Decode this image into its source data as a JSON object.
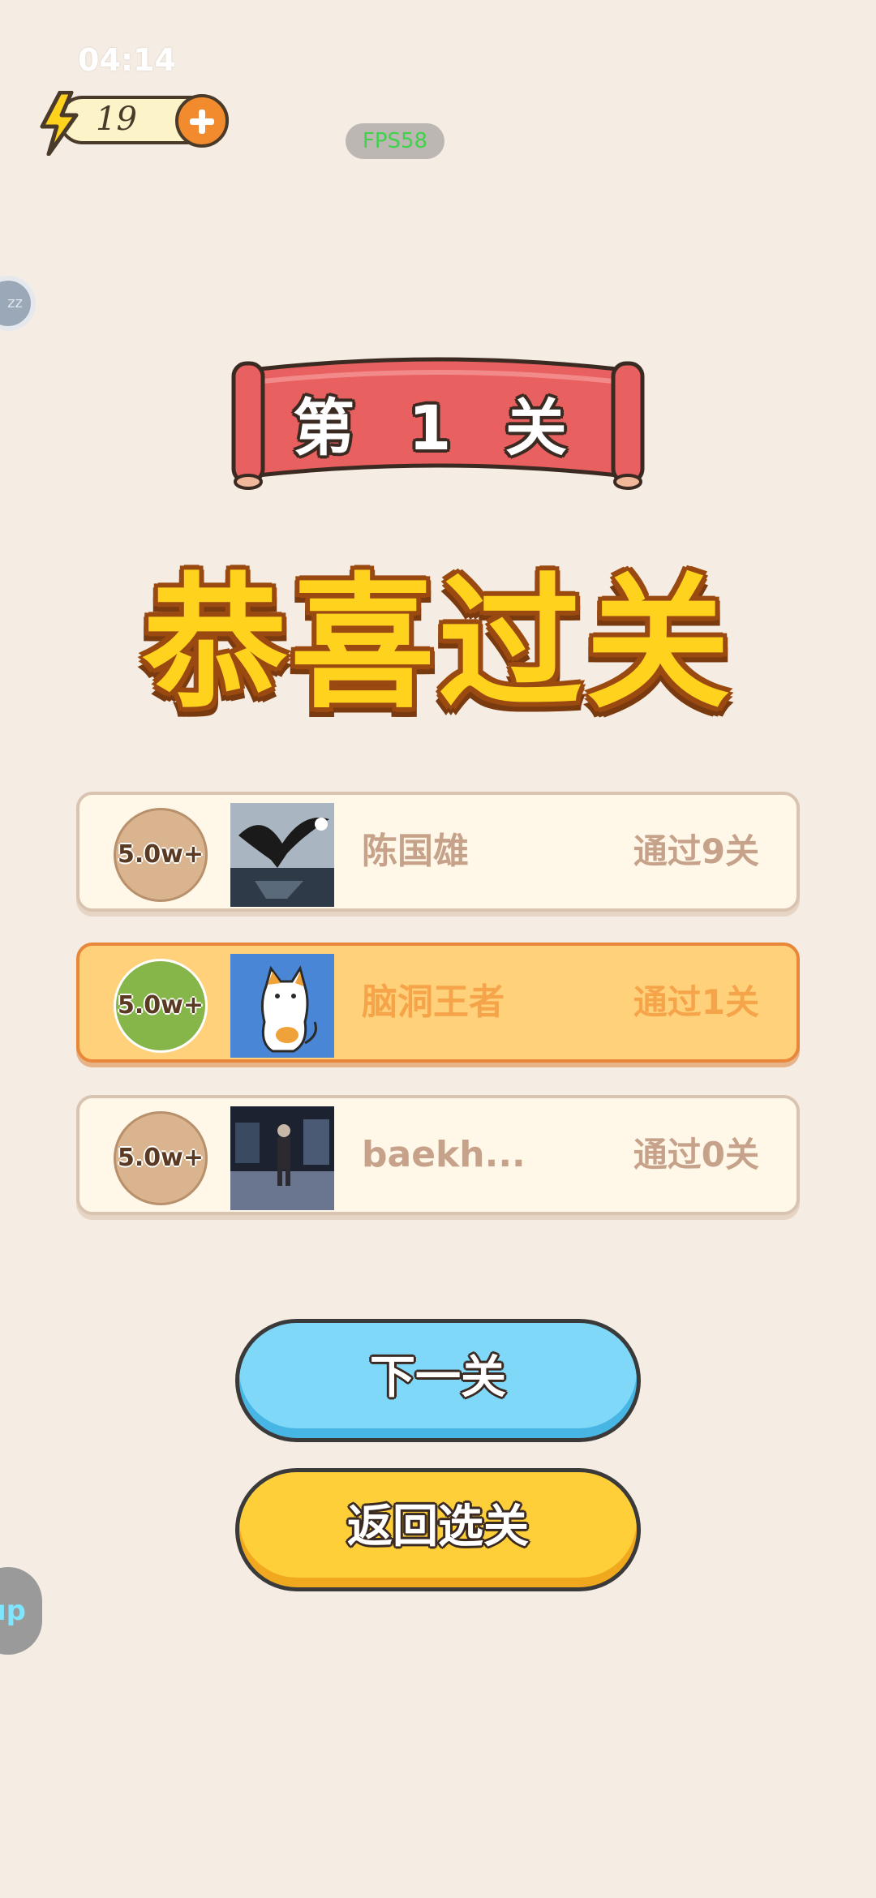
{
  "status": {
    "time": "04:14"
  },
  "energy": {
    "count": "19"
  },
  "fps": "FPS58",
  "float_buttons": {
    "zz": "zz",
    "up": "up"
  },
  "banner": {
    "level": "第 1 关"
  },
  "congrats": "恭喜过关",
  "ranking": [
    {
      "badge": "5.0w+",
      "name": "陈国雄",
      "progress": "通过9关",
      "highlight": false,
      "avatar": "eagle-avatar"
    },
    {
      "badge": "5.0w+",
      "name": "脑洞王者",
      "progress": "通过1关",
      "highlight": true,
      "avatar": "cat-avatar"
    },
    {
      "badge": "5.0w+",
      "name": "baekh...",
      "progress": "通过0关",
      "highlight": false,
      "avatar": "person-avatar"
    }
  ],
  "buttons": {
    "next": "下一关",
    "back": "返回选关"
  },
  "colors": {
    "background": "#f5ece3",
    "next_button": "#7fd8f8",
    "back_button": "#ffcf3a",
    "banner": "#e8605f",
    "title": "#ffd21e"
  }
}
